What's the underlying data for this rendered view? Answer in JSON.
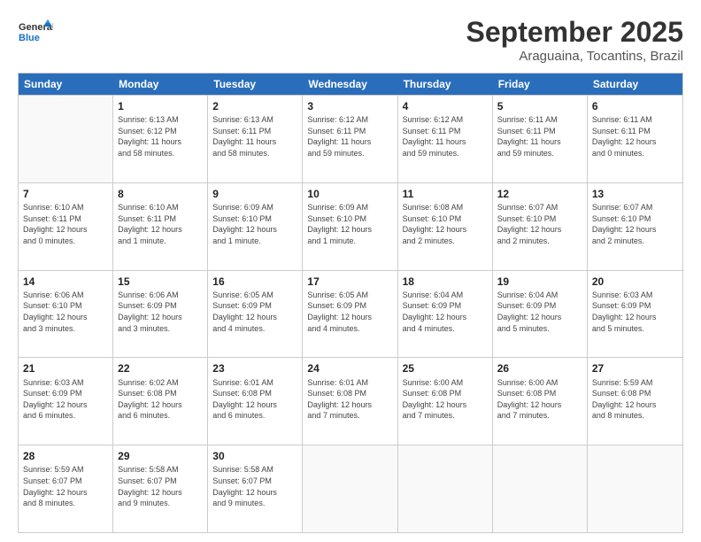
{
  "header": {
    "logo_general": "General",
    "logo_blue": "Blue",
    "month": "September 2025",
    "location": "Araguaina, Tocantins, Brazil"
  },
  "days_of_week": [
    "Sunday",
    "Monday",
    "Tuesday",
    "Wednesday",
    "Thursday",
    "Friday",
    "Saturday"
  ],
  "weeks": [
    [
      {
        "day": "",
        "info": ""
      },
      {
        "day": "1",
        "info": "Sunrise: 6:13 AM\nSunset: 6:12 PM\nDaylight: 11 hours\nand 58 minutes."
      },
      {
        "day": "2",
        "info": "Sunrise: 6:13 AM\nSunset: 6:11 PM\nDaylight: 11 hours\nand 58 minutes."
      },
      {
        "day": "3",
        "info": "Sunrise: 6:12 AM\nSunset: 6:11 PM\nDaylight: 11 hours\nand 59 minutes."
      },
      {
        "day": "4",
        "info": "Sunrise: 6:12 AM\nSunset: 6:11 PM\nDaylight: 11 hours\nand 59 minutes."
      },
      {
        "day": "5",
        "info": "Sunrise: 6:11 AM\nSunset: 6:11 PM\nDaylight: 11 hours\nand 59 minutes."
      },
      {
        "day": "6",
        "info": "Sunrise: 6:11 AM\nSunset: 6:11 PM\nDaylight: 12 hours\nand 0 minutes."
      }
    ],
    [
      {
        "day": "7",
        "info": "Sunrise: 6:10 AM\nSunset: 6:11 PM\nDaylight: 12 hours\nand 0 minutes."
      },
      {
        "day": "8",
        "info": "Sunrise: 6:10 AM\nSunset: 6:11 PM\nDaylight: 12 hours\nand 1 minute."
      },
      {
        "day": "9",
        "info": "Sunrise: 6:09 AM\nSunset: 6:10 PM\nDaylight: 12 hours\nand 1 minute."
      },
      {
        "day": "10",
        "info": "Sunrise: 6:09 AM\nSunset: 6:10 PM\nDaylight: 12 hours\nand 1 minute."
      },
      {
        "day": "11",
        "info": "Sunrise: 6:08 AM\nSunset: 6:10 PM\nDaylight: 12 hours\nand 2 minutes."
      },
      {
        "day": "12",
        "info": "Sunrise: 6:07 AM\nSunset: 6:10 PM\nDaylight: 12 hours\nand 2 minutes."
      },
      {
        "day": "13",
        "info": "Sunrise: 6:07 AM\nSunset: 6:10 PM\nDaylight: 12 hours\nand 2 minutes."
      }
    ],
    [
      {
        "day": "14",
        "info": "Sunrise: 6:06 AM\nSunset: 6:10 PM\nDaylight: 12 hours\nand 3 minutes."
      },
      {
        "day": "15",
        "info": "Sunrise: 6:06 AM\nSunset: 6:09 PM\nDaylight: 12 hours\nand 3 minutes."
      },
      {
        "day": "16",
        "info": "Sunrise: 6:05 AM\nSunset: 6:09 PM\nDaylight: 12 hours\nand 4 minutes."
      },
      {
        "day": "17",
        "info": "Sunrise: 6:05 AM\nSunset: 6:09 PM\nDaylight: 12 hours\nand 4 minutes."
      },
      {
        "day": "18",
        "info": "Sunrise: 6:04 AM\nSunset: 6:09 PM\nDaylight: 12 hours\nand 4 minutes."
      },
      {
        "day": "19",
        "info": "Sunrise: 6:04 AM\nSunset: 6:09 PM\nDaylight: 12 hours\nand 5 minutes."
      },
      {
        "day": "20",
        "info": "Sunrise: 6:03 AM\nSunset: 6:09 PM\nDaylight: 12 hours\nand 5 minutes."
      }
    ],
    [
      {
        "day": "21",
        "info": "Sunrise: 6:03 AM\nSunset: 6:09 PM\nDaylight: 12 hours\nand 6 minutes."
      },
      {
        "day": "22",
        "info": "Sunrise: 6:02 AM\nSunset: 6:08 PM\nDaylight: 12 hours\nand 6 minutes."
      },
      {
        "day": "23",
        "info": "Sunrise: 6:01 AM\nSunset: 6:08 PM\nDaylight: 12 hours\nand 6 minutes."
      },
      {
        "day": "24",
        "info": "Sunrise: 6:01 AM\nSunset: 6:08 PM\nDaylight: 12 hours\nand 7 minutes."
      },
      {
        "day": "25",
        "info": "Sunrise: 6:00 AM\nSunset: 6:08 PM\nDaylight: 12 hours\nand 7 minutes."
      },
      {
        "day": "26",
        "info": "Sunrise: 6:00 AM\nSunset: 6:08 PM\nDaylight: 12 hours\nand 7 minutes."
      },
      {
        "day": "27",
        "info": "Sunrise: 5:59 AM\nSunset: 6:08 PM\nDaylight: 12 hours\nand 8 minutes."
      }
    ],
    [
      {
        "day": "28",
        "info": "Sunrise: 5:59 AM\nSunset: 6:07 PM\nDaylight: 12 hours\nand 8 minutes."
      },
      {
        "day": "29",
        "info": "Sunrise: 5:58 AM\nSunset: 6:07 PM\nDaylight: 12 hours\nand 9 minutes."
      },
      {
        "day": "30",
        "info": "Sunrise: 5:58 AM\nSunset: 6:07 PM\nDaylight: 12 hours\nand 9 minutes."
      },
      {
        "day": "",
        "info": ""
      },
      {
        "day": "",
        "info": ""
      },
      {
        "day": "",
        "info": ""
      },
      {
        "day": "",
        "info": ""
      }
    ]
  ]
}
